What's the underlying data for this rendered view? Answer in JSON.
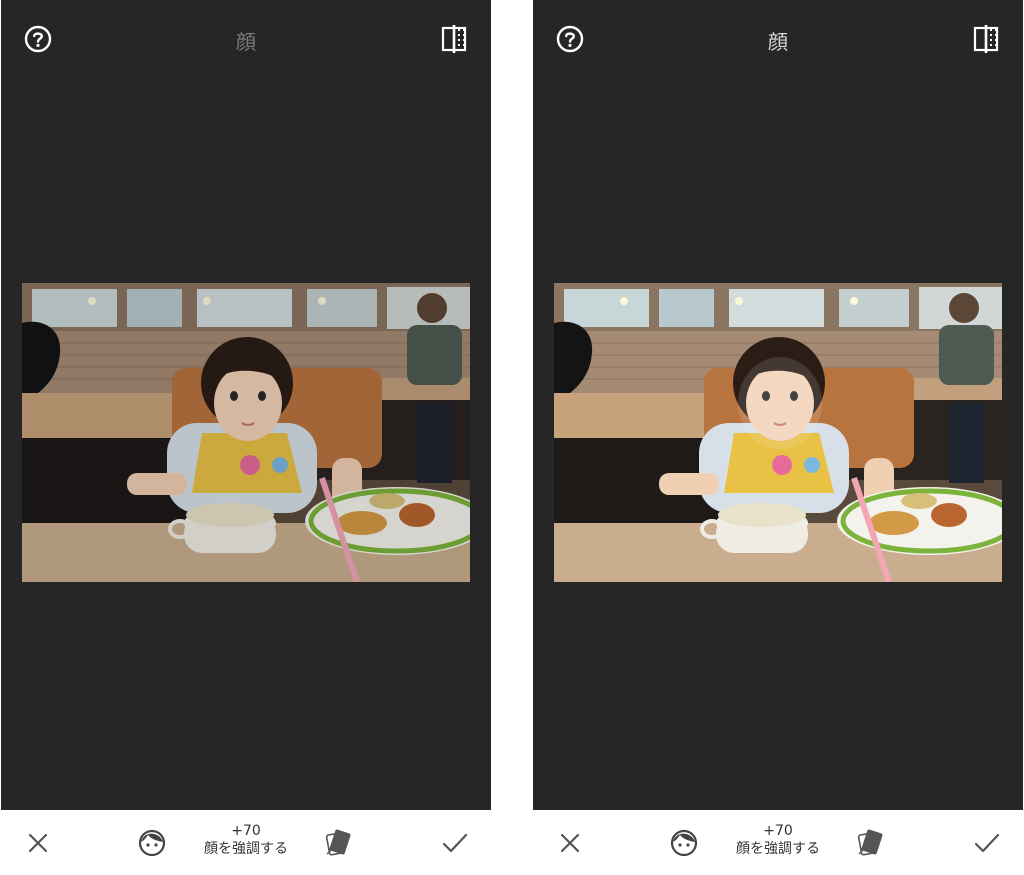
{
  "panels": [
    {
      "id": "before",
      "title": "顔",
      "adjust_value": "+70",
      "adjust_label": "顔を強調する",
      "photo_enhanced": false
    },
    {
      "id": "after",
      "title": "顔",
      "adjust_value": "+70",
      "adjust_label": "顔を強調する",
      "photo_enhanced": true
    }
  ],
  "icons": {
    "help": "help-icon",
    "compare": "compare-icon",
    "cancel": "close-icon",
    "face": "face-icon",
    "styles": "styles-icon",
    "apply": "check-icon"
  },
  "colors": {
    "screen_bg": "#262626",
    "page_bg": "#ffffff",
    "bar_icon": "#555555"
  }
}
